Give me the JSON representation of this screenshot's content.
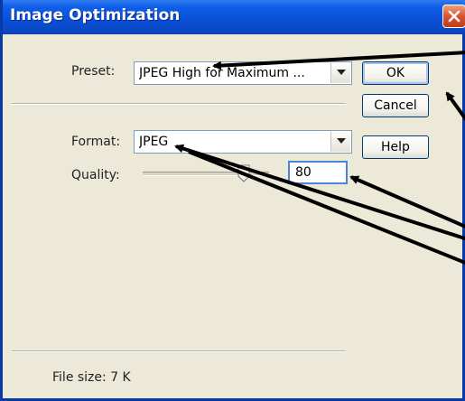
{
  "window": {
    "title": "Image Optimization"
  },
  "preset": {
    "label": "Preset:",
    "value": "JPEG High for Maximum ..."
  },
  "format": {
    "label": "Format:",
    "value": "JPEG"
  },
  "quality": {
    "label": "Quality:",
    "value": "80",
    "slider_level": 80
  },
  "buttons": {
    "ok": "OK",
    "cancel": "Cancel",
    "help": "Help"
  },
  "footer": {
    "file_size": "File size: 7 K"
  },
  "colors": {
    "titlebar": "#0a4fd6",
    "dialog_bg": "#ece9d8",
    "close_button": "#d8532f",
    "annotation_arrows": "#000000"
  },
  "icons": [
    "close-icon",
    "dropdown-arrow-icon"
  ]
}
